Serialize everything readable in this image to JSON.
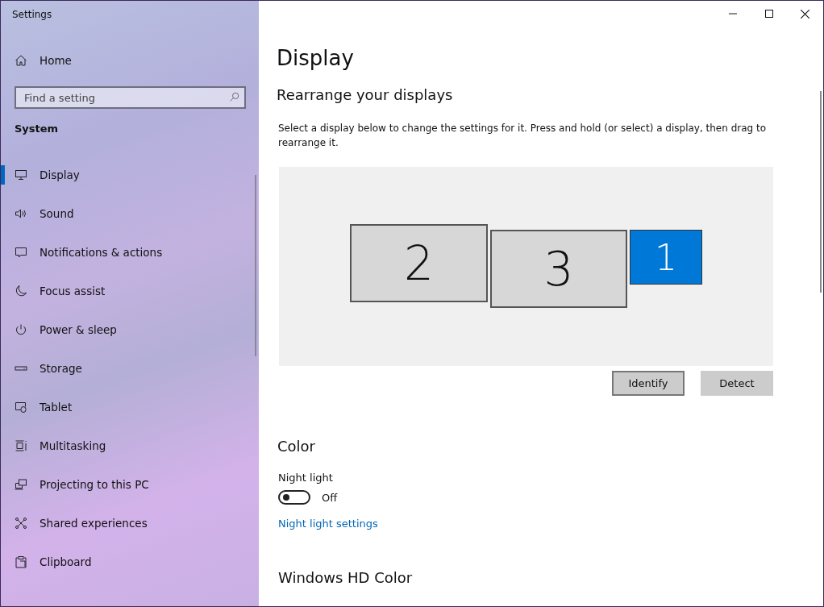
{
  "window": {
    "title": "Settings",
    "controls": [
      {
        "kind": "minimize"
      },
      {
        "kind": "maximize"
      },
      {
        "kind": "close"
      }
    ]
  },
  "sidebar": {
    "home": {
      "label": "Home"
    },
    "search": {
      "placeholder": "Find a setting"
    },
    "section": "System",
    "items": [
      {
        "label": "Display",
        "selected": true
      },
      {
        "label": "Sound",
        "selected": false
      },
      {
        "label": "Notifications & actions",
        "selected": false
      },
      {
        "label": "Focus assist",
        "selected": false
      },
      {
        "label": "Power & sleep",
        "selected": false
      },
      {
        "label": "Storage",
        "selected": false
      },
      {
        "label": "Tablet",
        "selected": false
      },
      {
        "label": "Multitasking",
        "selected": false
      },
      {
        "label": "Projecting to this PC",
        "selected": false
      },
      {
        "label": "Shared experiences",
        "selected": false
      },
      {
        "label": "Clipboard",
        "selected": false
      }
    ]
  },
  "page": {
    "title": "Display",
    "rearrange": {
      "heading": "Rearrange your displays",
      "description": "Select a display below to change the settings for it. Press and hold (or select) a display, then drag to rearrange it.",
      "displays": [
        {
          "number": "2",
          "selected": false
        },
        {
          "number": "3",
          "selected": false
        },
        {
          "number": "1",
          "selected": true
        }
      ],
      "buttons": [
        {
          "label": "Identify",
          "focused": true
        },
        {
          "label": "Detect",
          "focused": false
        }
      ]
    },
    "color": {
      "heading": "Color",
      "night_light": {
        "label": "Night light",
        "on": false,
        "state_text": "Off"
      },
      "link": "Night light settings"
    },
    "next_heading": "Windows HD Color"
  }
}
